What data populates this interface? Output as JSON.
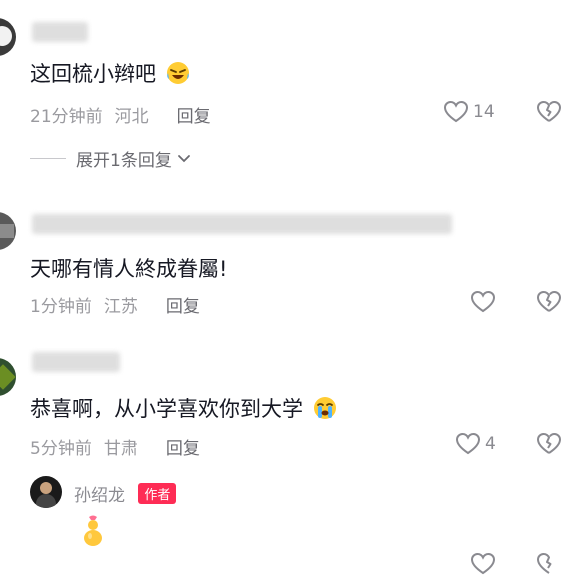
{
  "comments": [
    {
      "text": "这回梳小辫吧",
      "time": "21分钟前",
      "location": "河北",
      "reply_label": "回复",
      "like_count": "14",
      "emoji_icon": "laughing-tears-icon"
    },
    {
      "text": "天哪有情人終成眷屬!",
      "time": "1分钟前",
      "location": "江苏",
      "reply_label": "回复",
      "like_count": ""
    },
    {
      "text": "恭喜啊，从小学喜欢你到大学",
      "time": "5分钟前",
      "location": "甘肃",
      "reply_label": "回复",
      "like_count": "4",
      "emoji_icon": "crying-icon"
    }
  ],
  "expand_replies": {
    "label": "展开1条回复",
    "icon": "chevron-down-icon"
  },
  "author_reply": {
    "name": "孙绍龙",
    "tag": "作者",
    "sticker_icon": "gourd-sticker-icon"
  },
  "colors": {
    "author_tag_bg": "#fe2c55",
    "meta_text": "#9a9a9f",
    "icon_stroke": "#8a8a90"
  }
}
